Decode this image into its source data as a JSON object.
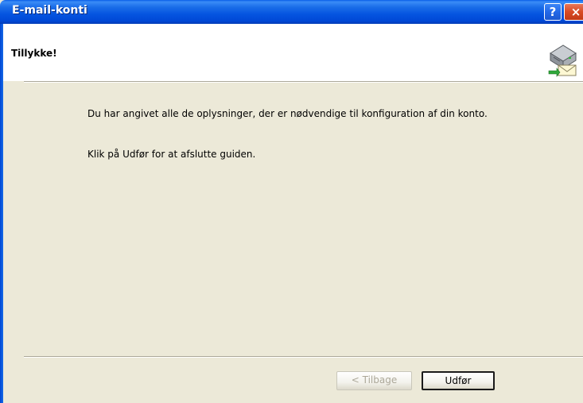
{
  "window": {
    "title": "E-mail-konti",
    "help_label": "?",
    "close_label": "×"
  },
  "header": {
    "title": "Tillykke!",
    "icon": "mail-server-icon"
  },
  "content": {
    "line1": "Du har angivet alle de oplysninger, der er nødvendige til konfiguration af din konto.",
    "line2": "Klik på Udfør for at afslutte guiden."
  },
  "buttons": {
    "back_label": "< Tilbage",
    "finish_label": "Udfør"
  },
  "colors": {
    "titlebar": "#0554e0",
    "dialog_bg": "#ece9d8",
    "close": "#d84a24"
  }
}
